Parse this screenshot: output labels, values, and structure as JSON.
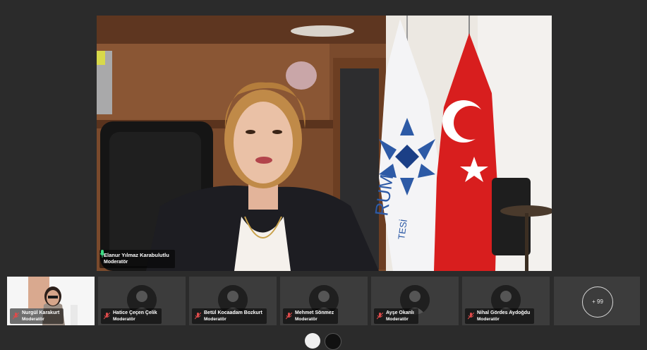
{
  "speaker": {
    "name": "Elanur Yılmaz Karabulutlu",
    "role": "Moderatör"
  },
  "participants": [
    {
      "name": "Nurgül Karakurt",
      "role": "Moderatör",
      "video": true
    },
    {
      "name": "Hatice Çeçen Çelik",
      "role": "Moderatör",
      "video": false
    },
    {
      "name": "Betül Kocaadam Bozkurt",
      "role": "Moderatör",
      "video": false
    },
    {
      "name": "Mehmet Sönmez",
      "role": "Moderatör",
      "video": false
    },
    {
      "name": "Ayşe Okanlı",
      "role": "Moderatör",
      "video": false
    },
    {
      "name": "Nihal Gördes Aydoğdu",
      "role": "Moderatör",
      "video": false
    }
  ],
  "more_participants": "+ 99",
  "flag_text": {
    "line1": "RUM",
    "line2": "TESİ"
  },
  "colors": {
    "background": "#2b2b2b",
    "tile": "#3c3c3c",
    "mic_on": "#3ddc84",
    "mic_off": "#e04b4b",
    "flag_red": "#d81e1e"
  }
}
